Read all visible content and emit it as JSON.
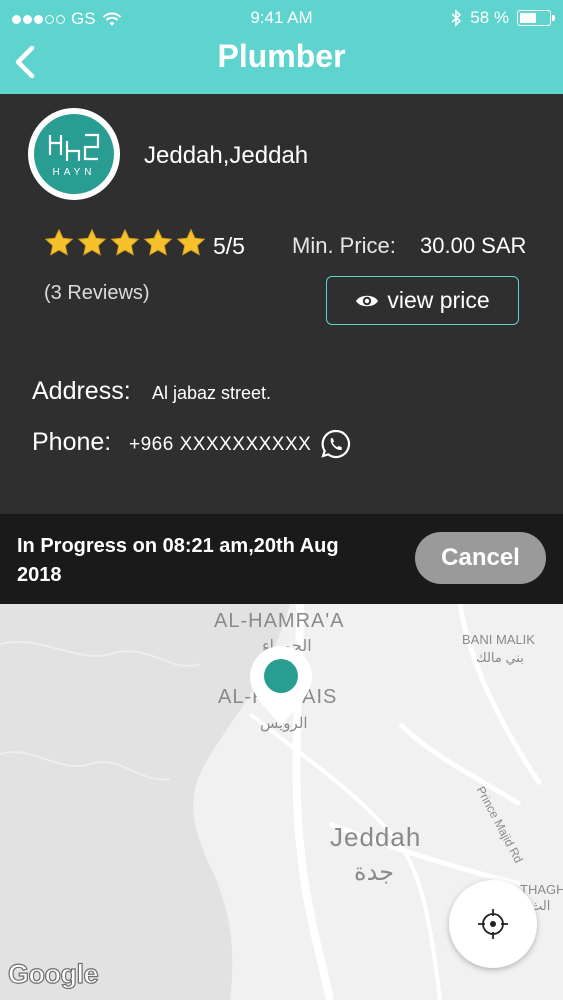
{
  "status_bar": {
    "carrier": "GS",
    "time": "9:41 AM",
    "battery": "58 %",
    "signal_bars": 3,
    "battery_level": 0.58
  },
  "nav": {
    "title": "Plumber",
    "back_icon": "chevron-left-icon"
  },
  "provider": {
    "logo_text": "HAYN",
    "location": "Jeddah,Jeddah",
    "stars": 5,
    "rating": "5/5",
    "reviews": "(3 Reviews)",
    "min_price_label": "Min. Price:",
    "min_price_value": "30.00 SAR",
    "view_price_label": "view price",
    "address_label": "Address:",
    "address_value": "Al jabaz street.",
    "phone_label": "Phone:",
    "phone_value": "+966 XXXXXXXXXX"
  },
  "order": {
    "status_text": "In Progress on 08:21 am,20th Aug 2018",
    "cancel_label": "Cancel"
  },
  "map": {
    "labels": {
      "al_hamra_en": "AL-HAMRA'A",
      "al_hamra_ar": "الحمراء",
      "bani_malik_en": "BANI MALIK",
      "bani_malik_ar": "بني مالك",
      "al_ruwais_en": "AL-RUWAIS",
      "al_ruwais_ar": "الرويس",
      "prince_majid": "Prince Majid Rd",
      "jeddah_en": "Jeddah",
      "jeddah_ar": "جدة",
      "thagh_en": "THAGH",
      "thagh_ar": "الث"
    },
    "attribution": "Google"
  },
  "colors": {
    "accent": "#5fd3cd",
    "card_bg": "#2f2f2f",
    "strip_bg": "#1a1a1a",
    "star": "#f6c12b",
    "pin": "#2a9d93",
    "cancel_bg": "#9a9a9a"
  }
}
